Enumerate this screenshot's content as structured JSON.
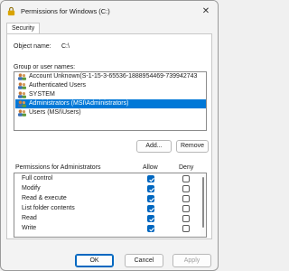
{
  "window": {
    "title": "Permissions for Windows (C:)",
    "close_glyph": "✕"
  },
  "tabs": [
    {
      "label": "Security"
    }
  ],
  "object": {
    "label": "Object name:",
    "value": "C:\\"
  },
  "groups": {
    "label": "Group or user names:",
    "items": [
      {
        "name": "Account Unknown(S-1-15-3-65536-1888954469-739942743",
        "icon": "users-icon",
        "selected": false
      },
      {
        "name": "Authenticated Users",
        "icon": "users-icon",
        "selected": false
      },
      {
        "name": "SYSTEM",
        "icon": "users-icon",
        "selected": false
      },
      {
        "name": "Administrators (MSI\\Administrators)",
        "icon": "users-icon",
        "selected": true
      },
      {
        "name": "Users (MSI\\Users)",
        "icon": "users-icon",
        "selected": false
      }
    ]
  },
  "group_buttons": {
    "add": "Add...",
    "remove": "Remove"
  },
  "permissions": {
    "header": "Permissions for Administrators",
    "allow_header": "Allow",
    "deny_header": "Deny",
    "rows": [
      {
        "name": "Full control",
        "allow": true,
        "deny": false
      },
      {
        "name": "Modify",
        "allow": true,
        "deny": false
      },
      {
        "name": "Read & execute",
        "allow": true,
        "deny": false
      },
      {
        "name": "List folder contents",
        "allow": true,
        "deny": false
      },
      {
        "name": "Read",
        "allow": true,
        "deny": false
      },
      {
        "name": "Write",
        "allow": true,
        "deny": false
      }
    ]
  },
  "footer": {
    "ok": "OK",
    "cancel": "Cancel",
    "apply": "Apply"
  },
  "colors": {
    "accent": "#0067c0",
    "selection": "#0078d7"
  }
}
